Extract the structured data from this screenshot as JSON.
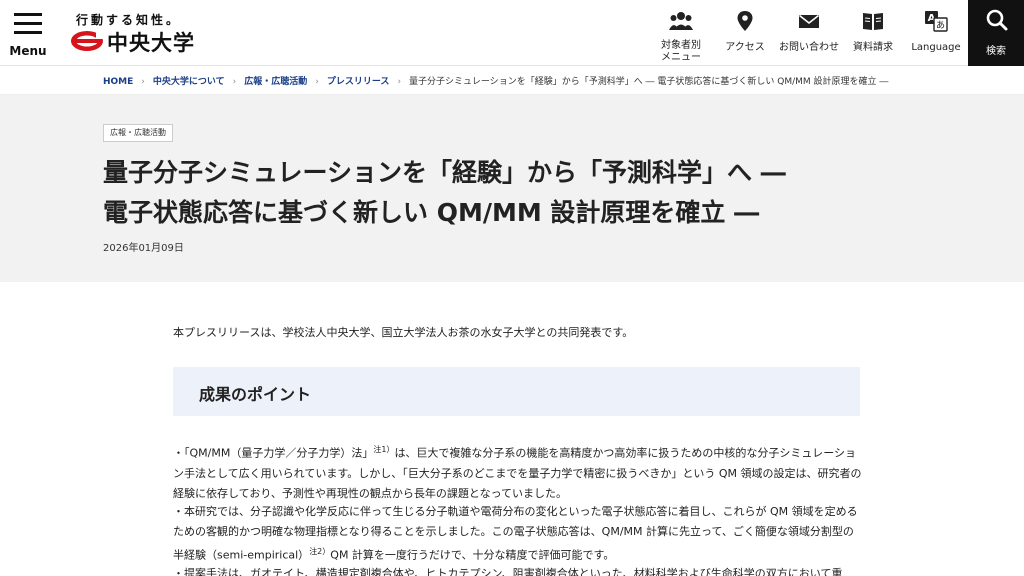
{
  "header": {
    "menu_label": "Menu",
    "slogan": "行動する知性。",
    "logo_name": "中央大学",
    "nav": [
      {
        "label_1": "対象者別",
        "label_2": "メニュー"
      },
      {
        "label": "アクセス"
      },
      {
        "label": "お問い合わせ"
      },
      {
        "label": "資料請求"
      },
      {
        "label": "Language"
      }
    ],
    "search_label": "検索"
  },
  "breadcrumb": {
    "items": [
      "HOME",
      "中央大学について",
      "広報・広聴活動",
      "プレスリリース"
    ],
    "current": "量子分子シミュレーションを「経験」から「予測科学」へ ― 電子状態応答に基づく新しい QM/MM 設計原理を確立 ―"
  },
  "article": {
    "category": "広報・広聴活動",
    "title_line1": "量子分子シミュレーションを「経験」から「予測科学」へ ―",
    "title_line2": "電子状態応答に基づく新しい QM/MM 設計原理を確立 ―",
    "date": "2026年01月09日",
    "intro": "本プレスリリースは、学校法人中央大学、国立大学法人お茶の水女子大学との共同発表です。",
    "points_heading": "成果のポイント",
    "p1_a": "・「QM/MM（量子力学／分子力学）法」",
    "p1_sup": "注1）",
    "p1_b": "は、巨大で複雑な分子系の機能を高精度かつ高効率に扱うための中核的な分子シミュレーション手法として広く用いられています。しかし、「巨大分子系のどこまでを量子力学で精密に扱うべきか」という QM 領域の設定は、研究者の経験に依存しており、予測性や再現性の観点から長年の課題となっていました。",
    "p2_a": "・本研究では、分子認識や化学反応に伴って生じる分子軌道や電荷分布の変化といった電子状態応答に着目し、これらが QM 領域を定めるための客観的かつ明確な物理指標となり得ることを示しました。この電子状態応答は、QM/MM 計算に先立って、ごく簡便な領域分割型の半経験（semi-empirical）",
    "p2_sup": "注2）",
    "p2_b": "QM 計算を一度行うだけで、十分な精度で評価可能です。",
    "p3": "・提案手法は、ガオテイト、構造規定剤複合体や、ヒトカテプシン、阻害剤複合体といった、材料科学および生命科学の双方において重"
  },
  "colors": {
    "link": "#1a3e87",
    "logo_red": "#d7141c",
    "hero_bg": "#f2f2f2",
    "points_bg": "#edf1f9",
    "search_bg": "#111111"
  }
}
